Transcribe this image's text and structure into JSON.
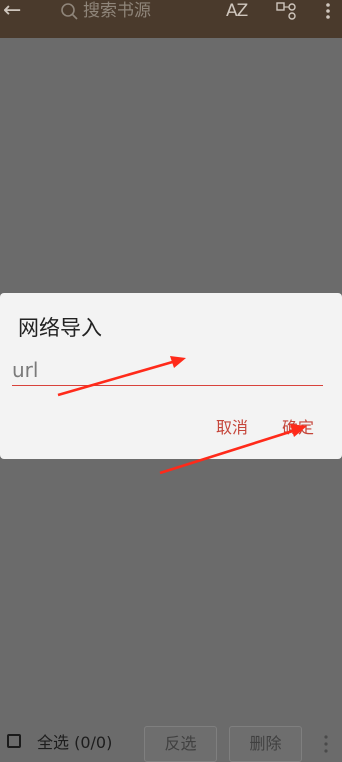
{
  "toolbar": {
    "back_icon": "arrow-left-icon",
    "search_placeholder": "搜索书源",
    "sort_label": "AZ",
    "group_icon": "group-icon",
    "more_icon": "more-vert-icon"
  },
  "dialog": {
    "title": "网络导入",
    "input_placeholder": "url",
    "cancel_label": "取消",
    "ok_label": "确定",
    "accent_color": "#d8423b"
  },
  "bottom_bar": {
    "select_all_label": "全选 (0/0)",
    "invert_label": "反选",
    "delete_label": "删除",
    "more_icon": "more-vert-icon"
  },
  "annotations": {
    "arrow_color": "#ff2a1a"
  }
}
